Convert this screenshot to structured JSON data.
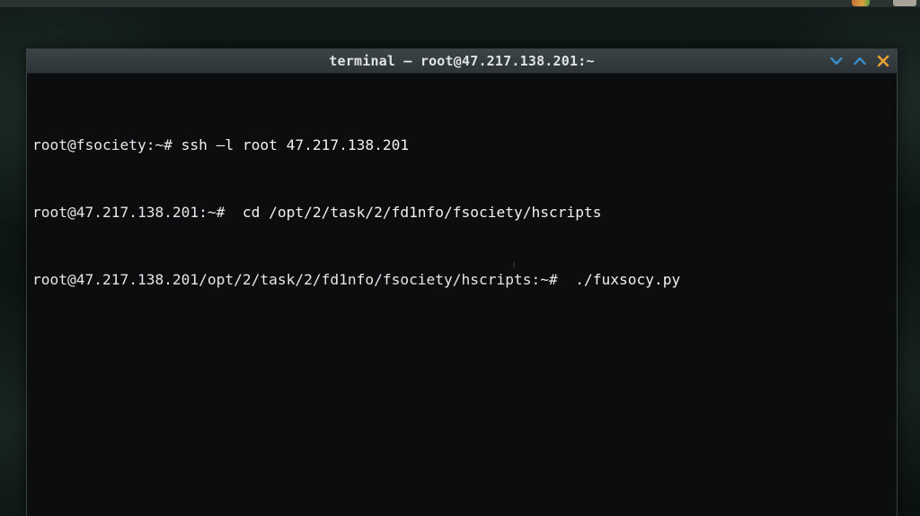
{
  "window": {
    "title": "terminal — root@47.217.138.201:~",
    "controls": {
      "minimize_icon": "chevron-down-icon",
      "maximize_icon": "chevron-up-icon",
      "close_icon": "close-icon"
    }
  },
  "terminal": {
    "lines": [
      {
        "prompt": "root@fsociety:~#",
        "command": " ssh —l root 47.217.138.201"
      },
      {
        "prompt": "root@47.217.138.201:~#",
        "command": "  cd /opt/2/task/2/fd1nfo/fsociety/hscripts"
      },
      {
        "prompt": "root@47.217.138.201/opt/2/task/2/fd1nfo/fsociety/hscripts:~#",
        "command": "  ./fuxsocy.py"
      }
    ]
  },
  "colors": {
    "terminal_bg": "#0b0d0e",
    "titlebar": "#343c3f",
    "text": "#e6e8e6",
    "control_blue": "#3a8fd0",
    "control_orange": "#e8a030"
  }
}
